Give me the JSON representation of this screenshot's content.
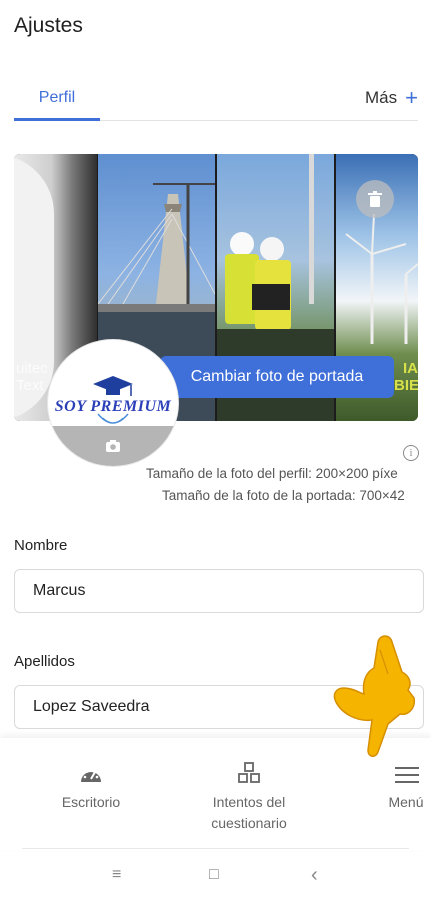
{
  "header": {
    "title": "Ajustes"
  },
  "tabs": {
    "profile": "Perfil",
    "more": "Más",
    "more_icon": "plus-icon"
  },
  "cover": {
    "change_cover_label": "Cambiar foto de portada",
    "trash_icon": "trash-icon",
    "overlay_left_text": "uitec\nText",
    "overlay_right_text": "IA\nBIE"
  },
  "avatar": {
    "logo_text": "SOY PREMIUM",
    "camera_icon": "camera-icon"
  },
  "size_info": {
    "profile_size": "Tamaño de la foto del perfil: 200×200 píxe",
    "cover_size": "Tamaño de la foto de la portada: 700×42"
  },
  "form": {
    "first_name_label": "Nombre",
    "first_name_value": "Marcus",
    "last_name_label": "Apellidos",
    "last_name_value": "Lopez Saveedra"
  },
  "bottom_nav": {
    "items": [
      {
        "label": "Escritorio",
        "icon": "dashboard-icon"
      },
      {
        "label": "Intentos del cuestionario",
        "icon": "quiz-attempts-icon"
      },
      {
        "label": "Menú",
        "icon": "hamburger-menu-icon"
      }
    ]
  },
  "system_nav": {
    "recents": "≡",
    "home": "□",
    "back": "‹"
  },
  "colors": {
    "accent": "#3f6fd8",
    "text": "#222222",
    "muted": "#666666"
  }
}
